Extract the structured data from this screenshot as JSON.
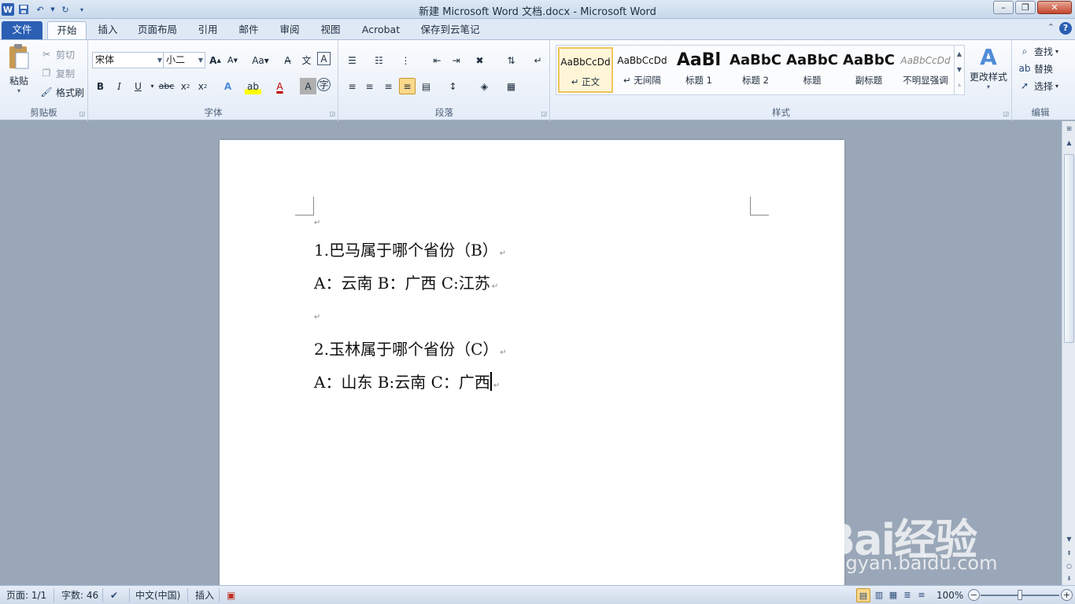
{
  "window": {
    "title": "新建 Microsoft Word 文档.docx  -  Microsoft Word",
    "word_logo": "W",
    "qat_icons": [
      "save-icon",
      "undo-icon",
      "redo-icon",
      "customize-icon"
    ]
  },
  "tabs": [
    {
      "label": "文件",
      "id": "file"
    },
    {
      "label": "开始",
      "id": "home"
    },
    {
      "label": "插入",
      "id": "insert"
    },
    {
      "label": "页面布局",
      "id": "layout"
    },
    {
      "label": "引用",
      "id": "references"
    },
    {
      "label": "邮件",
      "id": "mailings"
    },
    {
      "label": "审阅",
      "id": "review"
    },
    {
      "label": "视图",
      "id": "view"
    },
    {
      "label": "Acrobat",
      "id": "acrobat"
    },
    {
      "label": "保存到云笔记",
      "id": "cloudnote"
    }
  ],
  "ribbon": {
    "clipboard": {
      "label": "剪贴板",
      "paste": "粘贴",
      "cut": "剪切",
      "copy": "复制",
      "format_painter": "格式刷"
    },
    "font": {
      "label": "字体",
      "font_name": "宋体",
      "font_size": "小二"
    },
    "paragraph": {
      "label": "段落"
    },
    "styles": {
      "label": "样式",
      "items": [
        {
          "sample": "AaBbCcDd",
          "name": "↵ 正文",
          "selected": true
        },
        {
          "sample": "AaBbCcDd",
          "name": "↵ 无间隔",
          "selected": false
        },
        {
          "sample": "AaBl",
          "name": "标题 1",
          "selected": false
        },
        {
          "sample": "AaBbC",
          "name": "标题 2",
          "selected": false
        },
        {
          "sample": "AaBbC",
          "name": "标题",
          "selected": false
        },
        {
          "sample": "AaBbC",
          "name": "副标题",
          "selected": false
        },
        {
          "sample": "AaBbCcDd",
          "name": "不明显强调",
          "selected": false
        }
      ],
      "change_styles": "更改样式"
    },
    "editing": {
      "label": "编辑",
      "find": "查找",
      "replace": "替换",
      "select": "选择"
    }
  },
  "document": {
    "paragraphs": [
      "1.巴马属于哪个省份（B）",
      "A：云南 B：广西 C:江苏",
      "",
      "2.玉林属于哪个省份（C）",
      "A：山东 B:云南 C：广西"
    ]
  },
  "status": {
    "page": "页面: 1/1",
    "words": "字数: 46",
    "language": "中文(中国)",
    "mode": "插入",
    "zoom": "100%",
    "zoom_level_percent": 100
  },
  "watermark": {
    "brand": "Bai经验",
    "url": "jingyan.baidu.com"
  }
}
